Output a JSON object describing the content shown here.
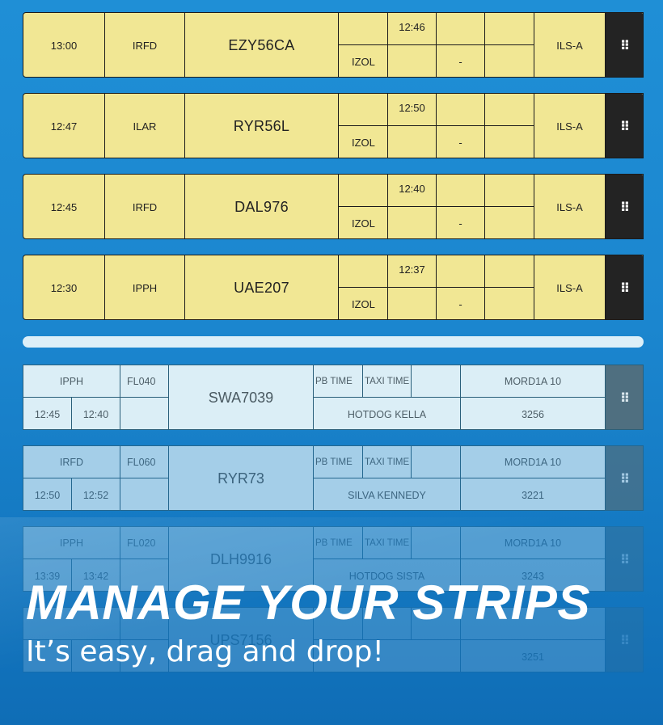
{
  "arrivals": [
    {
      "time": "13:00",
      "type": "IRFD",
      "callsign": "EZY56CA",
      "eta": "12:46",
      "fix": "IZOL",
      "dash": "-",
      "approach": "ILS-A"
    },
    {
      "time": "12:47",
      "type": "ILAR",
      "callsign": "RYR56L",
      "eta": "12:50",
      "fix": "IZOL",
      "dash": "-",
      "approach": "ILS-A"
    },
    {
      "time": "12:45",
      "type": "IRFD",
      "callsign": "DAL976",
      "eta": "12:40",
      "fix": "IZOL",
      "dash": "-",
      "approach": "ILS-A"
    },
    {
      "time": "12:30",
      "type": "IPPH",
      "callsign": "UAE207",
      "eta": "12:37",
      "fix": "IZOL",
      "dash": "-",
      "approach": "ILS-A"
    }
  ],
  "departures": [
    {
      "type": "IPPH",
      "fl": "FL040",
      "callsign": "SWA7039",
      "pb": "PB TIME",
      "taxi": "TAXI TIME",
      "sid": "MORD1A 10",
      "t1": "12:45",
      "t2": "12:40",
      "stand": "HOTDOG KELLA",
      "squawk": "3256"
    },
    {
      "type": "IRFD",
      "fl": "FL060",
      "callsign": "RYR73",
      "pb": "PB TIME",
      "taxi": "TAXI TIME",
      "sid": "MORD1A 10",
      "t1": "12:50",
      "t2": "12:52",
      "stand": "SILVA KENNEDY",
      "squawk": "3221"
    },
    {
      "type": "IPPH",
      "fl": "FL020",
      "callsign": "DLH9916",
      "pb": "PB TIME",
      "taxi": "TAXI TIME",
      "sid": "MORD1A 10",
      "t1": "13:39",
      "t2": "13:42",
      "stand": "HOTDOG SISTA",
      "squawk": "3243"
    },
    {
      "type": "",
      "fl": "",
      "callsign": "UPS7156",
      "pb": "",
      "taxi": "",
      "sid": "",
      "t1": "",
      "t2": "",
      "stand": "",
      "squawk": "3251"
    }
  ],
  "handle_glyph": "⠿",
  "headline": "MANAGE YOUR STRIPS",
  "subline": "It’s easy, drag and drop!",
  "colors": {
    "arrival_strip": "#f1e794",
    "departure_strip": "#dbeef6",
    "arrival_handle": "#232323",
    "departure_handle": "#4f6f80",
    "background": "#1b86cf"
  }
}
